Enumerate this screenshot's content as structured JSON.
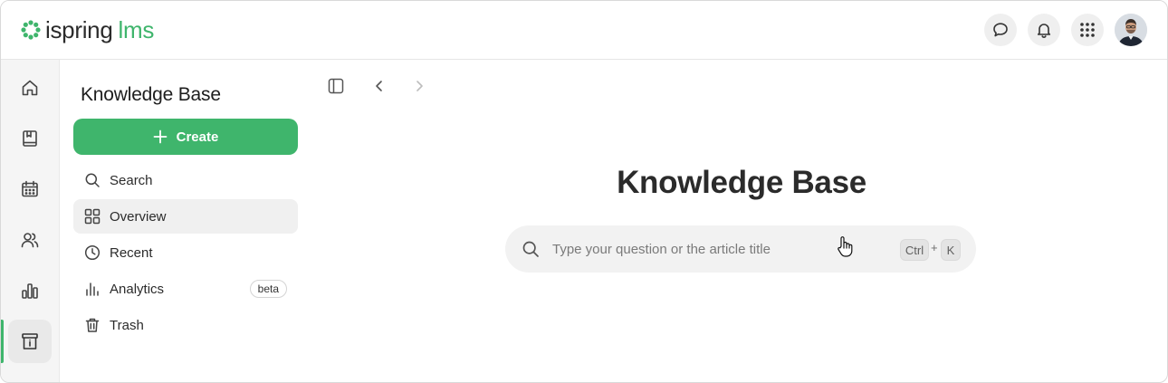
{
  "brand": {
    "name_part1": "ispring",
    "name_part2": "lms",
    "accent": "#3fb56c"
  },
  "header": {
    "buttons": [
      {
        "icon": "chat-bubble-icon"
      },
      {
        "icon": "bell-icon"
      },
      {
        "icon": "apps-grid-icon"
      }
    ],
    "avatar": {
      "icon": "user-avatar"
    }
  },
  "rail": {
    "items": [
      {
        "icon": "home-icon"
      },
      {
        "icon": "book-icon"
      },
      {
        "icon": "calendar-icon"
      },
      {
        "icon": "users-icon"
      },
      {
        "icon": "bar-chart-icon"
      },
      {
        "icon": "knowledge-base-icon",
        "active": true
      }
    ]
  },
  "panel": {
    "title": "Knowledge Base",
    "create_label": "Create",
    "nav": [
      {
        "label": "Search",
        "icon": "search-icon"
      },
      {
        "label": "Overview",
        "icon": "grid-icon",
        "active": true
      },
      {
        "label": "Recent",
        "icon": "clock-icon"
      },
      {
        "label": "Analytics",
        "icon": "analytics-icon",
        "badge": "beta"
      },
      {
        "label": "Trash",
        "icon": "trash-icon"
      }
    ]
  },
  "main": {
    "title": "Knowledge Base",
    "search": {
      "placeholder": "Type your question or the article title",
      "shortcut": {
        "key1": "Ctrl",
        "plus": "+",
        "key2": "K"
      }
    }
  }
}
